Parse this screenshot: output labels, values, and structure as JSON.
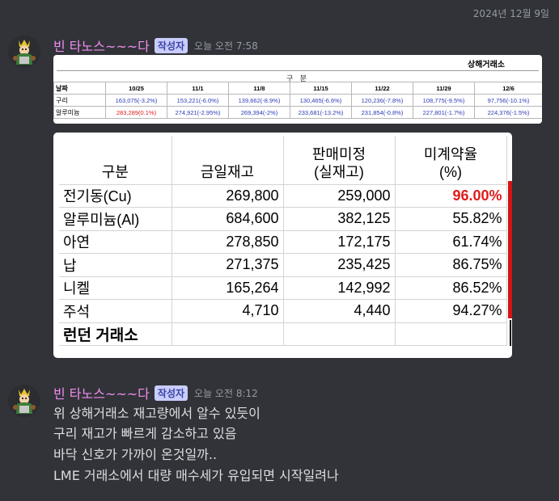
{
  "date_divider": "2024년 12월 9일",
  "messages": [
    {
      "username": "빈 타노스~~~다",
      "badge": "작성자",
      "timestamp": "오늘 오전 7:58"
    },
    {
      "username": "빈 타노스~~~다",
      "badge": "작성자",
      "timestamp": "오늘 오전 8:12",
      "lines": [
        "위 상해거래소 재고량에서 알수 있듯이",
        "구리 재고가 빠르게 감소하고 있음",
        "바닥 신호가 가까이 온것일까..",
        "LME 거래소에서 대량 매수세가 유입되면  시작일려나"
      ]
    }
  ],
  "shanghai_table": {
    "exchange": "상해거래소",
    "section": "구 분",
    "date_label": "날짜",
    "dates": [
      "10/25",
      "11/1",
      "11/8",
      "11/15",
      "11/22",
      "11/29",
      "12/6"
    ],
    "rows": [
      {
        "label": "구리",
        "values": [
          "163,075(-3.2%)",
          "153,221(-6.0%)",
          "139,662(-8.9%)",
          "130,465(-6.6%)",
          "120,236(-7.8%)",
          "108,775(-9.5%)",
          "97,756(-10.1%)"
        ]
      },
      {
        "label": "알루미늄",
        "values": [
          "283,289(0.1%)",
          "274,921(-2.95%)",
          "269,394(-2%)",
          "233,681(-13.2%)",
          "231,854(-0.8%)",
          "227,801(-1.7%)",
          "224,376(-1.5%)"
        ]
      }
    ]
  },
  "lme_table": {
    "headers": [
      "구분",
      "금일재고",
      "판매미정\n(실재고)",
      "미계약율\n(%)"
    ],
    "header_lines": {
      "c0": [
        "구분"
      ],
      "c1": [
        "금일재고"
      ],
      "c2": [
        "판매미정",
        "(실재고)"
      ],
      "c3": [
        "미계약율",
        "(%)"
      ]
    },
    "rows": [
      {
        "name": "전기동(Cu)",
        "stock": "269,800",
        "unsold": "259,000",
        "ratio": "96.00%"
      },
      {
        "name": "알루미늄(Al)",
        "stock": "684,600",
        "unsold": "382,125",
        "ratio": "55.82%"
      },
      {
        "name": "아연",
        "stock": "278,850",
        "unsold": "172,175",
        "ratio": "61.74%"
      },
      {
        "name": "납",
        "stock": "271,375",
        "unsold": "235,425",
        "ratio": "86.75%"
      },
      {
        "name": "니켈",
        "stock": "165,264",
        "unsold": "142,992",
        "ratio": "86.52%"
      },
      {
        "name": "주석",
        "stock": "4,710",
        "unsold": "4,440",
        "ratio": "94.27%"
      }
    ],
    "footer": "런던 거래소",
    "highlight_color": "#e01b1b"
  },
  "colors": {
    "background": "#313338",
    "username": "#f08cf0",
    "badge_bg": "#c9cdfb"
  }
}
